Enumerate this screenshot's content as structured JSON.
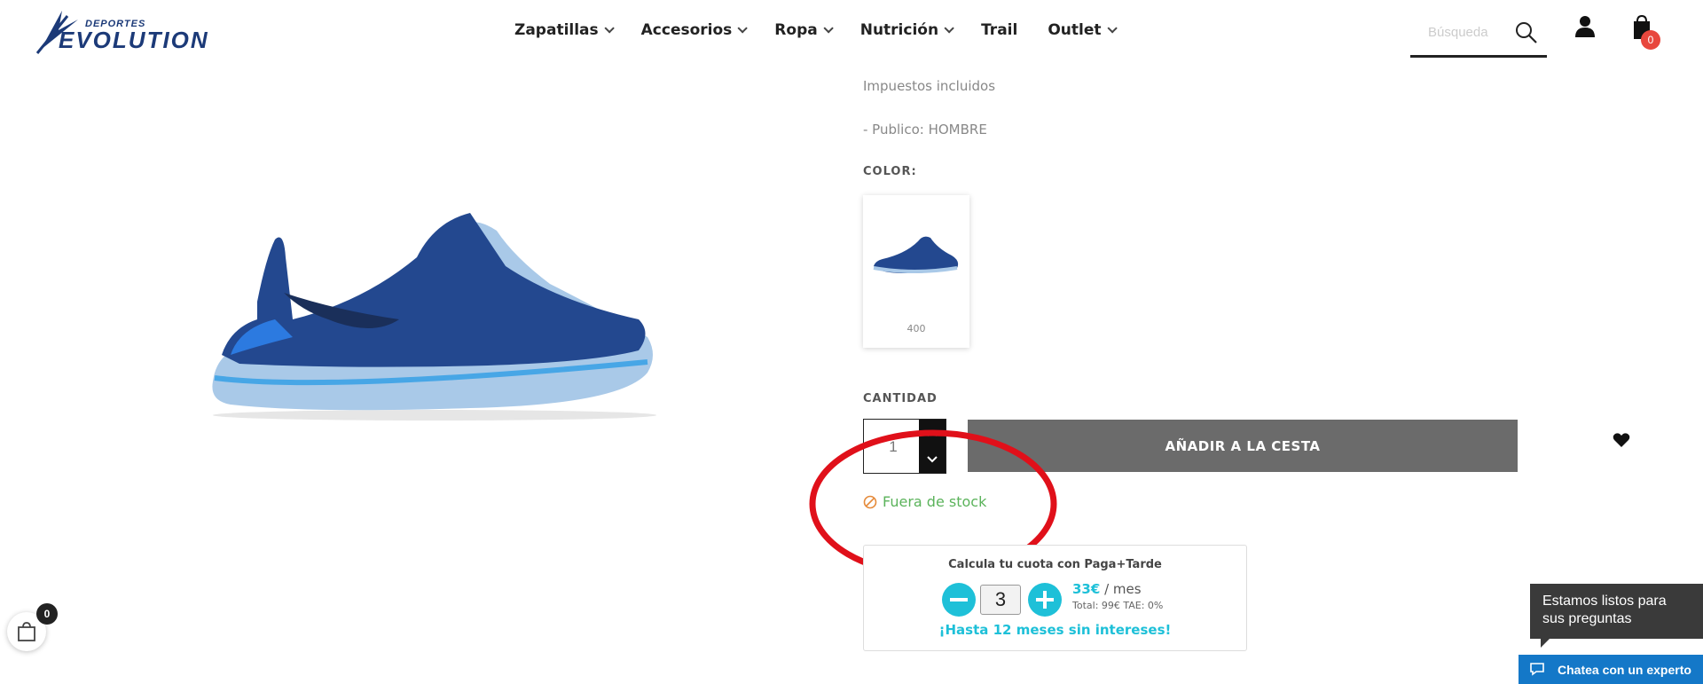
{
  "brand": {
    "logo_alt": "Deportes Evolution",
    "logo_line1": "DEPORTES",
    "logo_line2": "EVOLUTION"
  },
  "nav": {
    "items": [
      {
        "label": "Zapatillas",
        "dropdown": true
      },
      {
        "label": "Accesorios",
        "dropdown": true
      },
      {
        "label": "Ropa",
        "dropdown": true
      },
      {
        "label": "Nutrición",
        "dropdown": true
      },
      {
        "label": "Trail",
        "dropdown": false
      },
      {
        "label": "Outlet",
        "dropdown": true
      }
    ]
  },
  "search": {
    "placeholder": "Búsqueda"
  },
  "header_icons": {
    "search": "search-icon",
    "account": "user-icon",
    "cart": "shopping-bag-icon",
    "cart_count": "0"
  },
  "product": {
    "tax_note": "Impuestos incluidos",
    "audience": "- Publico: HOMBRE",
    "color_label": "COLOR:",
    "color_options": [
      {
        "label": "400"
      }
    ],
    "quantity_label": "CANTIDAD",
    "quantity_value": "1",
    "add_to_cart": "AÑADIR A LA CESTA",
    "stock_status": "Fuera de stock"
  },
  "financing": {
    "title": "Calcula tu cuota con Paga+Tarde",
    "months": "3",
    "monthly_amount": "33€",
    "monthly_suffix": " / mes",
    "total": "Total: 99€ TAE: 0%",
    "promo": "¡Hasta 12 meses sin intereses!"
  },
  "mini_cart": {
    "count": "0"
  },
  "chat": {
    "bubble": "Estamos listos para sus preguntas",
    "button": "Chatea con un experto"
  },
  "colors": {
    "accent_cyan": "#1ec0d8",
    "cart_badge": "#e8473d",
    "stock_green": "#5bb35b",
    "chat_blue": "#1478c8",
    "annotation_red": "#e0101a"
  }
}
